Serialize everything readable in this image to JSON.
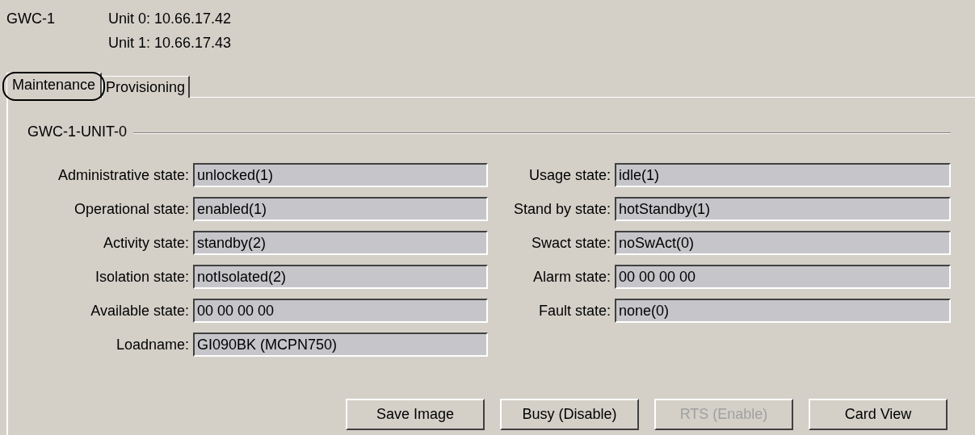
{
  "header": {
    "device": "GWC-1",
    "units": [
      "Unit 0:  10.66.17.42",
      "Unit 1:  10.66.17.43"
    ]
  },
  "tabs": [
    {
      "label": "Maintenance",
      "selected": true,
      "circled": true
    },
    {
      "label": "Provisioning",
      "selected": false,
      "circled": false
    }
  ],
  "group": {
    "title": "GWC-1-UNIT-0",
    "left_fields": [
      {
        "label": "Administrative state:",
        "value": "unlocked(1)"
      },
      {
        "label": "Operational state:",
        "value": "enabled(1)"
      },
      {
        "label": "Activity state:",
        "value": "standby(2)"
      },
      {
        "label": "Isolation state:",
        "value": "notIsolated(2)"
      },
      {
        "label": "Available state:",
        "value": "00 00 00 00"
      },
      {
        "label": "Loadname:",
        "value": "GI090BK (MCPN750)"
      }
    ],
    "right_fields": [
      {
        "label": "Usage state:",
        "value": "idle(1)"
      },
      {
        "label": "Stand by state:",
        "value": "hotStandby(1)"
      },
      {
        "label": "Swact state:",
        "value": "noSwAct(0)"
      },
      {
        "label": "Alarm state:",
        "value": "00 00 00 00"
      },
      {
        "label": "Fault state:",
        "value": "none(0)"
      }
    ]
  },
  "buttons": [
    {
      "label": "Save Image",
      "disabled": false
    },
    {
      "label": "Busy (Disable)",
      "disabled": false
    },
    {
      "label": "RTS (Enable)",
      "disabled": true
    },
    {
      "label": "Card View",
      "disabled": false
    }
  ]
}
